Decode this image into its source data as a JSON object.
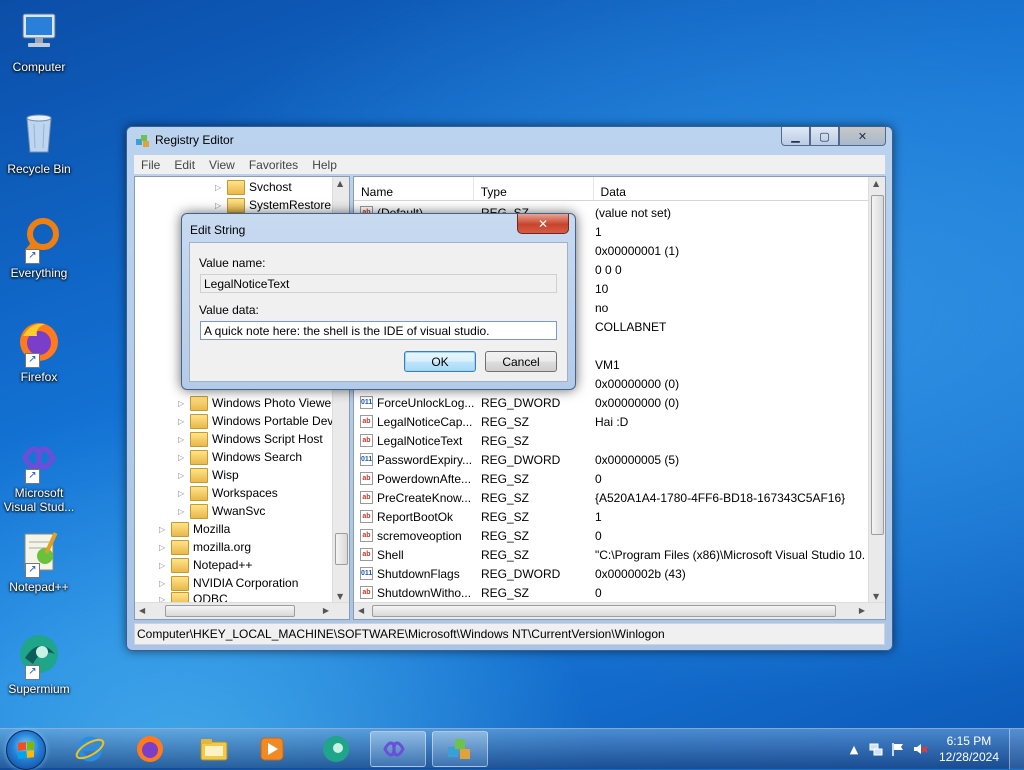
{
  "desktop": {
    "icons": [
      {
        "label": "Computer",
        "icon": "computer-icon"
      },
      {
        "label": "Recycle Bin",
        "icon": "recycle-bin-icon"
      },
      {
        "label": "Everything",
        "icon": "everything-icon"
      },
      {
        "label": "Firefox",
        "icon": "firefox-icon"
      },
      {
        "label": "Microsoft Visual Stud...",
        "icon": "visual-studio-icon"
      },
      {
        "label": "Notepad++",
        "icon": "notepad-plus-plus-icon"
      },
      {
        "label": "Supermium",
        "icon": "supermium-icon"
      }
    ]
  },
  "window": {
    "title": "Registry Editor",
    "menu": [
      "File",
      "Edit",
      "View",
      "Favorites",
      "Help"
    ],
    "tree": {
      "items": [
        "Svchost",
        "SystemRestore",
        "Windows Photo Viewer",
        "Windows Portable Devices",
        "Windows Script Host",
        "Windows Search",
        "Wisp",
        "Workspaces",
        "WwanSvc",
        "Mozilla",
        "mozilla.org",
        "Notepad++",
        "NVIDIA Corporation",
        "ODBC"
      ]
    },
    "list": {
      "columns": [
        "Name",
        "Type",
        "Data"
      ],
      "rows": [
        {
          "name": "(Default)",
          "type": "REG_SZ",
          "data": "(value not set)",
          "kind": "sz"
        },
        {
          "name": "",
          "type": "",
          "data": "1",
          "kind": "none"
        },
        {
          "name": "",
          "type": "",
          "data": "0x00000001 (1)",
          "kind": "none"
        },
        {
          "name": "",
          "type": "",
          "data": "0 0 0",
          "kind": "none"
        },
        {
          "name": "",
          "type": "",
          "data": "10",
          "kind": "none"
        },
        {
          "name": "",
          "type": "",
          "data": "no",
          "kind": "none"
        },
        {
          "name": "",
          "type": "",
          "data": "COLLABNET",
          "kind": "none"
        },
        {
          "name": "",
          "type": "",
          "data": "",
          "kind": "none"
        },
        {
          "name": "",
          "type": "",
          "data": "VM1",
          "kind": "none"
        },
        {
          "name": "",
          "type": "",
          "data": "0x00000000 (0)",
          "kind": "none"
        },
        {
          "name": "ForceUnlockLog...",
          "type": "REG_DWORD",
          "data": "0x00000000 (0)",
          "kind": "dw"
        },
        {
          "name": "LegalNoticeCap...",
          "type": "REG_SZ",
          "data": "Hai :D",
          "kind": "sz"
        },
        {
          "name": "LegalNoticeText",
          "type": "REG_SZ",
          "data": "",
          "kind": "sz"
        },
        {
          "name": "PasswordExpiry...",
          "type": "REG_DWORD",
          "data": "0x00000005 (5)",
          "kind": "dw"
        },
        {
          "name": "PowerdownAfte...",
          "type": "REG_SZ",
          "data": "0",
          "kind": "sz"
        },
        {
          "name": "PreCreateKnow...",
          "type": "REG_SZ",
          "data": "{A520A1A4-1780-4FF6-BD18-167343C5AF16}",
          "kind": "sz"
        },
        {
          "name": "ReportBootOk",
          "type": "REG_SZ",
          "data": "1",
          "kind": "sz"
        },
        {
          "name": "scremoveoption",
          "type": "REG_SZ",
          "data": "0",
          "kind": "sz"
        },
        {
          "name": "Shell",
          "type": "REG_SZ",
          "data": "\"C:\\Program Files (x86)\\Microsoft Visual Studio 10.",
          "kind": "sz"
        },
        {
          "name": "ShutdownFlags",
          "type": "REG_DWORD",
          "data": "0x0000002b (43)",
          "kind": "dw"
        },
        {
          "name": "ShutdownWitho...",
          "type": "REG_SZ",
          "data": "0",
          "kind": "sz"
        }
      ]
    },
    "status_path": "Computer\\HKEY_LOCAL_MACHINE\\SOFTWARE\\Microsoft\\Windows NT\\CurrentVersion\\Winlogon"
  },
  "dialog": {
    "title": "Edit String",
    "value_name_label": "Value name:",
    "value_name": "LegalNoticeText",
    "value_data_label": "Value data:",
    "value_data": "A quick note here: the shell is the IDE of visual studio.",
    "ok_label": "OK",
    "cancel_label": "Cancel",
    "close_glyph": "✕"
  },
  "taskbar": {
    "pinned": [
      "internet-explorer-icon",
      "firefox-icon",
      "file-explorer-icon",
      "media-player-icon",
      "supermium-icon",
      "visual-studio-icon",
      "registry-editor-icon"
    ],
    "clock_time": "6:15 PM",
    "clock_date": "12/28/2024"
  },
  "win_buttons": {
    "min": "▁",
    "max": "▢",
    "close": "✕"
  }
}
